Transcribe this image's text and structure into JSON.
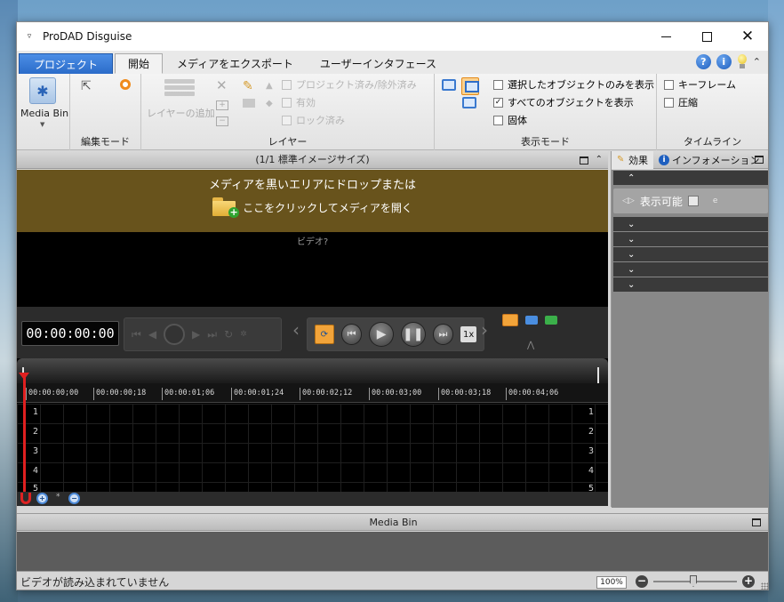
{
  "window": {
    "title": "ProDAD Disguise",
    "menu_glyph": "▿"
  },
  "window_controls": {
    "minimize": "",
    "maximize": "",
    "close": "✕"
  },
  "tabs": [
    {
      "label": "プロジェクト"
    },
    {
      "label": "開始"
    },
    {
      "label": "メディアをエクスポート"
    },
    {
      "label": "ユーザーインタフェース"
    }
  ],
  "ribbon": {
    "media_bin": {
      "label": "Media Bin",
      "icon": "puzzle-icon"
    },
    "edit_mode": {
      "group_label": "編集モード"
    },
    "layer": {
      "group_label": "レイヤー",
      "add_label": "レイヤーの追加",
      "options": [
        {
          "label": "プロジェクト済み/除外済み",
          "checked": false
        },
        {
          "label": "有効",
          "checked": false
        },
        {
          "label": "ロック済み",
          "checked": false
        }
      ]
    },
    "view_mode": {
      "group_label": "表示モード",
      "options": [
        {
          "label": "選択したオブジェクトのみを表示",
          "checked": false,
          "mark": ""
        },
        {
          "label": "すべてのオブジェクトを表示",
          "checked": true,
          "mark": "✓"
        },
        {
          "label": "固体",
          "checked": false,
          "mark": ""
        }
      ]
    },
    "timeline": {
      "group_label": "タイムライン",
      "options": [
        {
          "label": "キーフレーム",
          "checked": false
        },
        {
          "label": "圧縮",
          "checked": false
        }
      ]
    }
  },
  "preview": {
    "header": "(1/1  標準イメージサイズ)",
    "drop_text": "メディアを黒いエリアにドロップまたは",
    "open_text": "ここをクリックしてメディアを開く",
    "video_label": "ビデオ?"
  },
  "transport": {
    "timecode": "00:00:00:00",
    "speed": "1x"
  },
  "timeline": {
    "ticks": [
      "00:00:00;00",
      "00:00:00;18",
      "00:00:01;06",
      "00:00:01;24",
      "00:00:02;12",
      "00:00:03;00",
      "00:00:03;18",
      "00:00:04;06"
    ],
    "tracks": [
      "1",
      "2",
      "3",
      "4",
      "5"
    ]
  },
  "right_panel": {
    "tab_effects": "効果",
    "tab_info": "インフォメーション",
    "visible_label": "表示可能",
    "collapse_glyph": "⌃",
    "expand_glyph": "⌄",
    "e_glyph": "e"
  },
  "media_bin_panel": {
    "title": "Media Bin"
  },
  "status": {
    "text": "ビデオが読み込まれていません",
    "zoom": "100%"
  },
  "colors": {
    "accent": "#2b6cc9",
    "drop_area": "#68531c",
    "playhead": "#e02020",
    "active_highlight": "#f2a43a"
  }
}
